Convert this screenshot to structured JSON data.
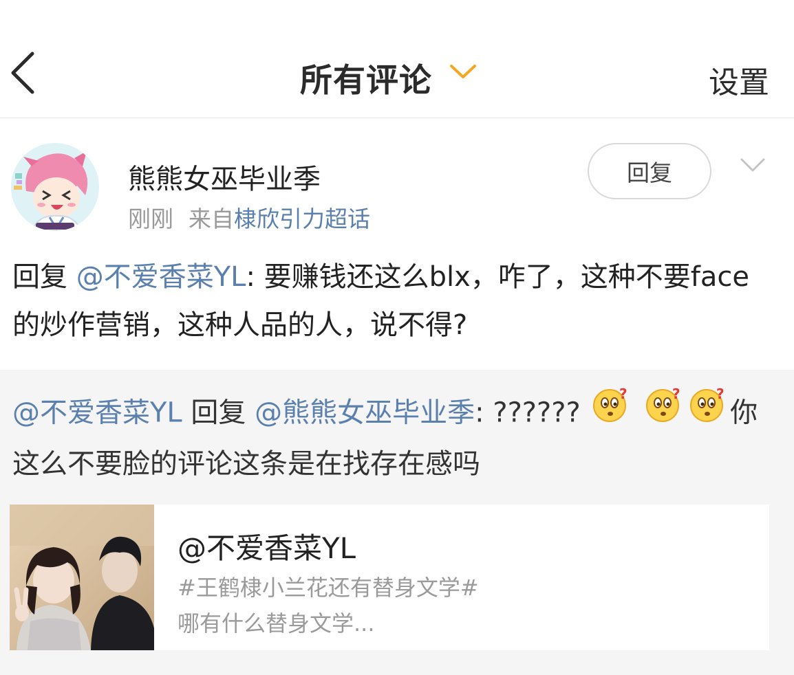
{
  "header": {
    "title": "所有评论",
    "settings_label": "设置"
  },
  "comment": {
    "username": "熊熊女巫毕业季",
    "time": "刚刚",
    "source_prefix": "来自",
    "source_link": "棣欣引力超话",
    "reply_button": "回复",
    "text_prefix": "回复 ",
    "mention": "@不爱香菜YL",
    "text_body": ": 要赚钱还这么blx，咋了，这种不要face的炒作营销，这种人品的人，说不得?"
  },
  "reply": {
    "author": "@不爱香菜YL",
    "reply_word": " 回复 ",
    "target": "@熊熊女巫毕业季",
    "text_start": ": ??????",
    "text_end": "你这么不要脸的评论这条是在找存在感吗",
    "emoji_name": "confused-face-icon"
  },
  "card": {
    "title": "@不爱香菜YL",
    "tag": "#王鹤棣小兰花还有替身文学#",
    "description": "哪有什么替身文学..."
  },
  "colors": {
    "accent_link": "#5b80ad",
    "chevron_orange": "#f5a623",
    "muted_text": "#9a9a9a",
    "reply_bg": "#f5f5f5"
  }
}
